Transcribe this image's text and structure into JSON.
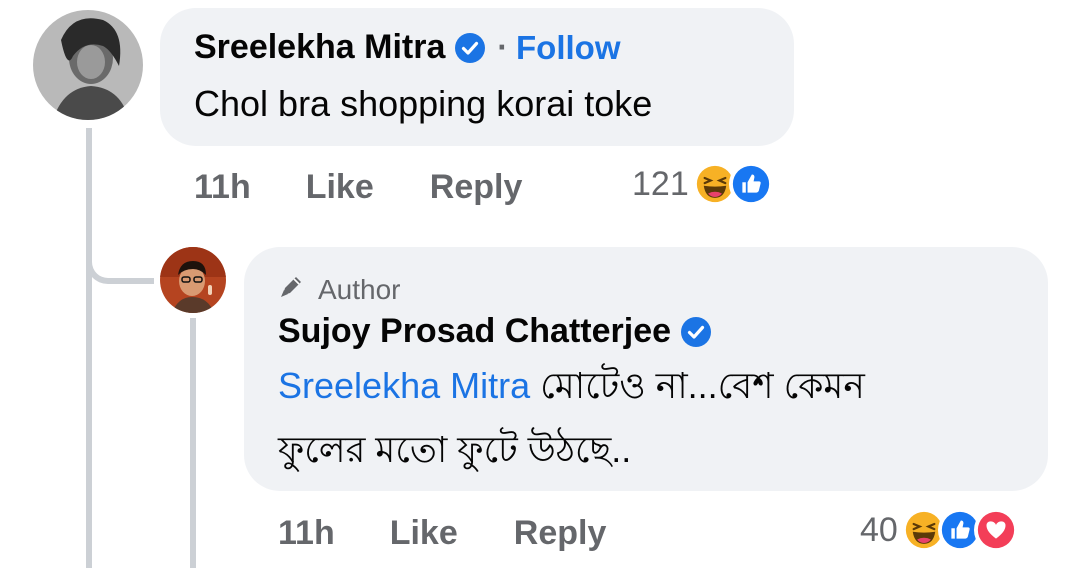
{
  "comment": {
    "author": "Sreelekha Mitra",
    "follow_label": "Follow",
    "separator": "·",
    "text": "Chol bra shopping korai toke",
    "time": "11h",
    "like_label": "Like",
    "reply_label": "Reply",
    "reaction_count": "121",
    "reactions": [
      "haha-icon",
      "like-icon"
    ]
  },
  "reply": {
    "badge": "Author",
    "author": "Sujoy Prosad Chatterjee",
    "mention": "Sreelekha Mitra",
    "text_line1": " মোটেও না...বেশ কেমন",
    "text_line2": "ফুলের মতো ফুটে উঠছে..",
    "time": "11h",
    "like_label": "Like",
    "reply_label": "Reply",
    "reaction_count": "40",
    "reactions": [
      "haha-icon",
      "like-icon",
      "love-icon"
    ]
  },
  "colors": {
    "link_blue": "#1b74e4",
    "bubble_bg": "#f0f2f5",
    "meta_gray": "#65676b",
    "thread_line": "#ccd0d5"
  }
}
